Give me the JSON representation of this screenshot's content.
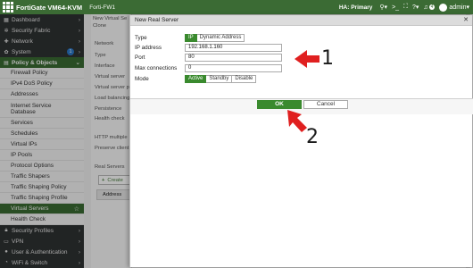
{
  "topbar": {
    "brand": "FortiGate VM64-KVM",
    "device": "Forti-FW1",
    "ha_status": "HA: Primary",
    "notification_count": "4",
    "user": "admin",
    "icons": [
      "search-icon",
      "terminal-icon",
      "fullscreen-icon",
      "help-icon",
      "bell-icon",
      "user-avatar-icon"
    ]
  },
  "sidebar": {
    "top_items": [
      {
        "label": "Dashboard",
        "icon": "dashboard-icon"
      },
      {
        "label": "Security Fabric",
        "icon": "fabric-icon"
      },
      {
        "label": "Network",
        "icon": "network-icon"
      },
      {
        "label": "System",
        "icon": "gear-icon",
        "badge": "1"
      },
      {
        "label": "Policy & Objects",
        "icon": "policy-icon"
      }
    ],
    "sub_items": [
      "Firewall Policy",
      "IPv4 DoS Policy",
      "Addresses",
      "Internet Service Database",
      "Services",
      "Schedules",
      "Virtual IPs",
      "IP Pools",
      "Protocol Options",
      "Traffic Shapers",
      "Traffic Shaping Policy",
      "Traffic Shaping Profile",
      "Virtual Servers",
      "Health Check"
    ],
    "bottom_items": [
      {
        "label": "Security Profiles",
        "icon": "lock-icon"
      },
      {
        "label": "VPN",
        "icon": "vpn-icon"
      },
      {
        "label": "User & Authentication",
        "icon": "user-icon"
      },
      {
        "label": "WiFi & Switch",
        "icon": "wifi-icon"
      }
    ]
  },
  "background_page": {
    "title": "New Virtual Se",
    "title2": "Clone",
    "labels": [
      "Network",
      "Type",
      "Interface",
      "Virtual server",
      "Virtual server p",
      "Load balancing",
      "Persistence",
      "Health check",
      "HTTP multiple",
      "Preserve client",
      "Real Servers"
    ],
    "create_button": "Create",
    "table_header": "Address"
  },
  "dialog": {
    "title": "New Real Server",
    "type_label": "Type",
    "type_options": [
      "IP",
      "Dynamic Address"
    ],
    "type_selected": "IP",
    "ip_label": "IP address",
    "ip_value": "192.168.1.160",
    "port_label": "Port",
    "port_value": "80",
    "maxconn_label": "Max connections",
    "maxconn_value": "0",
    "mode_label": "Mode",
    "mode_options": [
      "Active",
      "Standby",
      "Disable"
    ],
    "mode_selected": "Active",
    "ok_label": "OK",
    "cancel_label": "Cancel"
  },
  "annotations": {
    "label_1": "1",
    "label_2": "2",
    "color": "#e02020"
  },
  "colors": {
    "topbar": "#3b6b34",
    "sidebar": "#2f3233",
    "active_green": "#3a8a2e"
  }
}
